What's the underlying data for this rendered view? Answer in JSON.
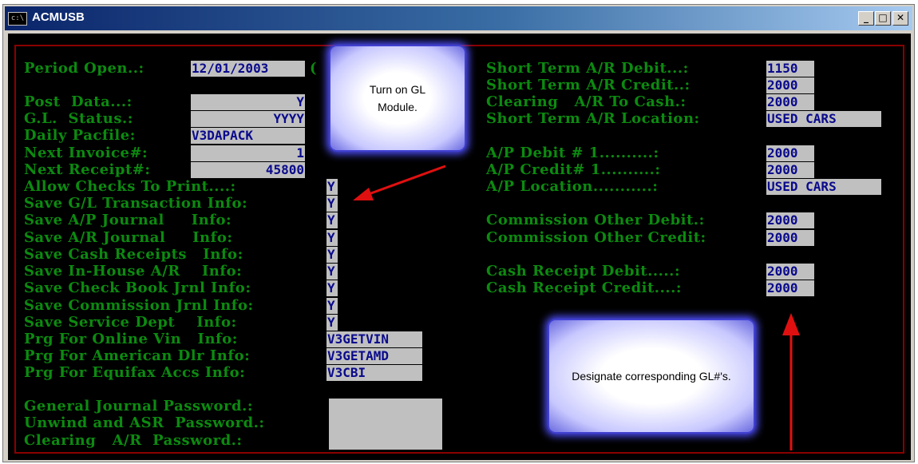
{
  "window": {
    "title": "ACMUSB",
    "icon": "c:\\",
    "minimize": "_",
    "maximize": "□",
    "close": "✕"
  },
  "left": {
    "period_label": "Period Open..:",
    "period_value": "12/01/2003",
    "period_suffix": "(",
    "post_label": "Post  Data...:",
    "post_value": "Y",
    "gl_label": "G.L.  Status.:",
    "gl_value": "YYYY",
    "pacfile_label": "Daily Pacfile:",
    "pacfile_value": "V3DAPACK",
    "invoice_label": "Next Invoice#:",
    "invoice_value": "1",
    "receipt_label": "Next Receipt#:",
    "receipt_value": "45800",
    "checks_label": "Allow Checks To Print....:",
    "checks_value": "Y",
    "save_gl_label": "Save G/L Transaction Info:",
    "save_gl_value": "Y",
    "save_ap_label": "Save A/P Journal     Info:",
    "save_ap_value": "Y",
    "save_ar_label": "Save A/R Journal     Info:",
    "save_ar_value": "Y",
    "save_cash_label": "Save Cash Receipts   Info:",
    "save_cash_value": "Y",
    "save_inhouse_label": "Save In-House A/R    Info:",
    "save_inhouse_value": "Y",
    "save_check_label": "Save Check Book Jrnl Info:",
    "save_check_value": "Y",
    "save_comm_label": "Save Commission Jrnl Info:",
    "save_comm_value": "Y",
    "save_service_label": "Save Service Dept    Info:",
    "save_service_value": "Y",
    "prg_online_label": "Prg For Online Vin   Info:",
    "prg_online_value": "V3GETVIN",
    "prg_american_label": "Prg For American Dlr Info:",
    "prg_american_value": "V3GETAMD",
    "prg_equifax_label": "Prg For Equifax Accs Info:",
    "prg_equifax_value": "V3CBI",
    "pw_general_label": "General Journal Password.:",
    "pw_unwind_label": "Unwind and ASR  Password.:",
    "pw_clearing_label": "Clearing   A/R  Password.:"
  },
  "right": {
    "st_debit_label": "Short Term A/R Debit...:",
    "st_debit_value": "1150",
    "st_credit_label": "Short Term A/R Credit..:",
    "st_credit_value": "2000",
    "clearing_label": "Clearing   A/R To Cash.:",
    "clearing_value": "2000",
    "st_location_label": "Short Term A/R Location:",
    "st_location_value": "USED CARS",
    "ap_debit_label": "A/P Debit # 1..........:",
    "ap_debit_value": "2000",
    "ap_credit_label": "A/P Credit# 1..........:",
    "ap_credit_value": "2000",
    "ap_location_label": "A/P Location...........:",
    "ap_location_value": "USED CARS",
    "comm_debit_label": "Commission Other Debit.:",
    "comm_debit_value": "2000",
    "comm_credit_label": "Commission Other Credit:",
    "comm_credit_value": "2000",
    "cash_debit_label": "Cash Receipt Debit.....:",
    "cash_debit_value": "2000",
    "cash_credit_label": "Cash Receipt Credit....:",
    "cash_credit_value": "2000"
  },
  "callouts": {
    "gl_module": "Turn on GL Module.",
    "designate": "Designate corresponding GL#'s."
  },
  "colors": {
    "label_green": "#0c8a10",
    "value_blue": "#0a0a8c",
    "field_gray": "#c0c0c0",
    "frame_red": "#8a0000",
    "arrow_red": "#e01010"
  }
}
